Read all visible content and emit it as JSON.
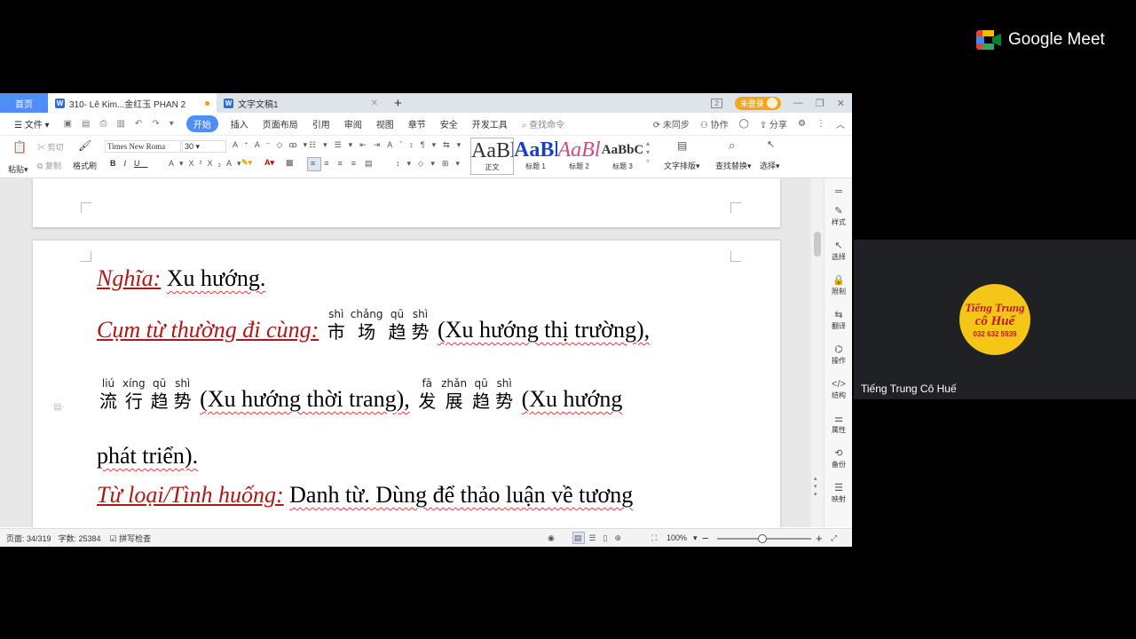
{
  "meet": {
    "brand": "Google Meet"
  },
  "participant": {
    "name": "Tiếng Trung Cô Huế",
    "logo_line1": "Tiếng Trung",
    "logo_line2": "cô Huế",
    "logo_phone": "032 632 5939"
  },
  "tabs": {
    "home": "首页",
    "doc1": "310- Lê Kim...金红玉 PHAN 2",
    "doc2": "文字文稿1",
    "plus": "+"
  },
  "window": {
    "badge": "2",
    "login": "未登录"
  },
  "menu": {
    "file": "文件",
    "items": [
      "开始",
      "插入",
      "页面布局",
      "引用",
      "审阅",
      "视图",
      "章节",
      "安全",
      "开发工具"
    ],
    "search_placeholder": "查找命令",
    "sync": "未同步",
    "collab": "协作",
    "share": "分享"
  },
  "ribbon": {
    "paste": "粘贴",
    "cut": "剪切",
    "copy": "复制",
    "format_painter": "格式刷",
    "font_name": "Times New Roma",
    "font_size": "30",
    "styles": [
      {
        "preview": "AaBl",
        "label": "正文",
        "color": "#000000"
      },
      {
        "preview": "AaBl",
        "label": "标题 1",
        "color": "#1a3fc6"
      },
      {
        "preview": "AaBl",
        "label": "标题 2",
        "color": "#d04a8a"
      },
      {
        "preview": "AaBbC",
        "label": "标题 3",
        "color": "#000000"
      }
    ],
    "text_layout": "文字排版",
    "find_replace": "查找替换",
    "select": "选择"
  },
  "document": {
    "line1_label": "Nghĩa:",
    "line1_text": "Xu hướng.",
    "line2_label": "Cụm từ thường đi cùng:",
    "ruby1": [
      {
        "py": "shì",
        "hz": "市"
      },
      {
        "py": "chǎng",
        "hz": "场"
      },
      {
        "py": "qū",
        "hz": "趋"
      },
      {
        "py": "shì",
        "hz": "势"
      }
    ],
    "line2_text": "(Xu hướng thị trường),",
    "ruby2": [
      {
        "py": "liú",
        "hz": "流"
      },
      {
        "py": "xíng",
        "hz": "行"
      },
      {
        "py": "qū",
        "hz": "趋"
      },
      {
        "py": "shì",
        "hz": "势"
      }
    ],
    "line3_mid": "(Xu hướng thời trang),",
    "ruby3": [
      {
        "py": "fā",
        "hz": "发"
      },
      {
        "py": "zhǎn",
        "hz": "展"
      },
      {
        "py": "qū",
        "hz": "趋"
      },
      {
        "py": "shì",
        "hz": "势"
      }
    ],
    "line3_end": "(Xu hướng",
    "line4_text": "phát triển).",
    "line5_label": "Từ loại/Tình huống:",
    "line5_text": "Danh từ. Dùng để thảo luận về tương"
  },
  "side_panel": [
    "样式",
    "选择",
    "限制",
    "翻译",
    "操作",
    "结构",
    "属性",
    "备份",
    "映射"
  ],
  "status": {
    "page": "页面: 34/319",
    "words": "字数: 25384",
    "spell": "拼写检查",
    "zoom": "100%"
  }
}
